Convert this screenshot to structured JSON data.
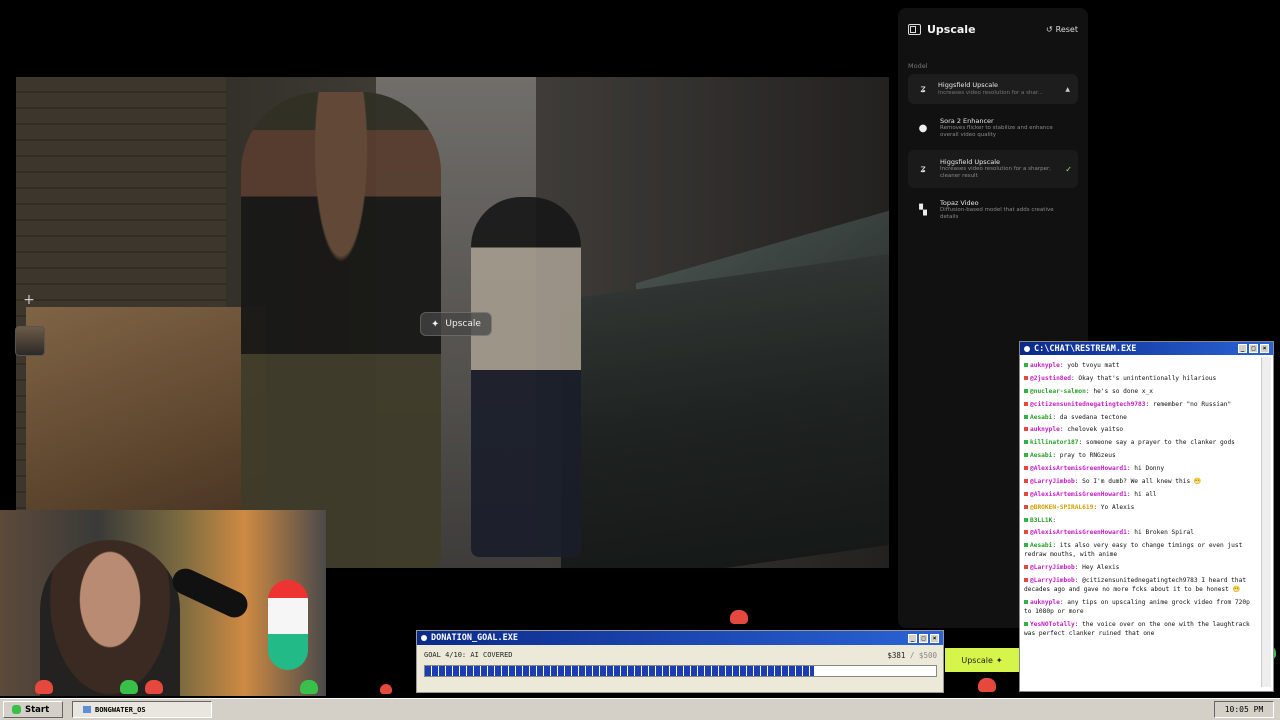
{
  "video": {
    "hover_button_label": "Upscale"
  },
  "panel": {
    "title": "Upscale",
    "reset_label": "Reset",
    "model_label": "Model",
    "selected": {
      "name": "Higgsfield Upscale",
      "desc": "Increases video resolution for a shar..."
    },
    "options": [
      {
        "name": "Sora 2 Enhancer",
        "desc": "Removes flicker to stabilize and enhance overall video quality",
        "icon": "sora-icon",
        "checked": false
      },
      {
        "name": "Higgsfield Upscale",
        "desc": "Increases video resolution for a sharper, cleaner result",
        "icon": "higgsfield-icon",
        "checked": true
      },
      {
        "name": "Topaz Video",
        "desc": "Diffusion-based model that adds creative details",
        "icon": "topaz-icon",
        "checked": false
      }
    ]
  },
  "donation": {
    "title": "DONATION_GOAL.EXE",
    "goal_label": "GOAL 4/10: AI COVERED",
    "amount": "$381",
    "total": "/ $500",
    "progress": 0.762,
    "progress_color": "#1b3fb0"
  },
  "upscale_tag": {
    "label": "Upscale"
  },
  "chat": {
    "title": "C:\\CHAT\\RESTREAM.EXE",
    "messages": [
      {
        "user": "auknyple",
        "text": "yob tvoyu matt",
        "color": "#c21cc2",
        "badge": "#2fb344"
      },
      {
        "user": "@2justin8ed",
        "text": "Okay that's unintentionally hilarious",
        "color": "#c21cc2",
        "badge": "#e5483c"
      },
      {
        "user": "@nuclear-salmon",
        "text": "he's so done x_x",
        "color": "#2a9d2a",
        "badge": "#2fb344"
      },
      {
        "user": "@citizensunitednegatingtech9783",
        "text": "remember \"no Russian\"",
        "color": "#c21cc2",
        "badge": "#e5483c"
      },
      {
        "user": "Aesabi",
        "text": "da svedana tectone",
        "color": "#2a9d2a",
        "badge": "#2fb344"
      },
      {
        "user": "auknyple",
        "text": "chelovek yaitso",
        "color": "#c21cc2",
        "badge": "#e5483c"
      },
      {
        "user": "killinator187",
        "text": "someone say a prayer to the clanker gods",
        "color": "#2a9d2a",
        "badge": "#2fb344"
      },
      {
        "user": "Aesabi",
        "text": "pray to RNGzeus",
        "color": "#2a9d2a",
        "badge": "#2fb344"
      },
      {
        "user": "@AlexisArtemisGreenHoward1",
        "text": "hi Donny",
        "color": "#c21cc2",
        "badge": "#e5483c"
      },
      {
        "user": "@LarryJimbob",
        "text": "So I'm dumb? We all knew this 😁",
        "color": "#c21cc2",
        "badge": "#e5483c"
      },
      {
        "user": "@AlexisArtemisGreenHoward1",
        "text": "hi all",
        "color": "#c21cc2",
        "badge": "#e5483c"
      },
      {
        "user": "@BROKEN-SPIRAL619",
        "text": "Yo Alexis",
        "color": "#d1a000",
        "badge": "#e5483c"
      },
      {
        "user": "B3LL1K",
        "text": "",
        "color": "#2a9d2a",
        "badge": "#2fb344"
      },
      {
        "user": "@AlexisArtemisGreenHoward1",
        "text": "hi Broken Spiral",
        "color": "#c21cc2",
        "badge": "#e5483c"
      },
      {
        "user": "Aesabi",
        "text": "its also very easy to change timings or even just redraw mouths, with anime",
        "color": "#2a9d2a",
        "badge": "#2fb344"
      },
      {
        "user": "@LarryJimbob",
        "text": "Hey Alexis",
        "color": "#c21cc2",
        "badge": "#e5483c"
      },
      {
        "user": "@LarryJimbob",
        "text": "@citizensunitednegatingtech9783 I heard that decades ago and gave no more fcks about it to be honest 😁",
        "color": "#c21cc2",
        "badge": "#e5483c"
      },
      {
        "user": "auknyple",
        "text": "any tips on upscaling anime grock video from 720p to 1080p or more",
        "color": "#c21cc2",
        "badge": "#2fb344"
      },
      {
        "user": "YesNOTotally",
        "text": "the voice over on the one with the laughtrack was perfect clanker ruined that one",
        "color": "#c21cc2",
        "badge": "#2fb344"
      }
    ]
  },
  "taskbar": {
    "start_label": "Start",
    "task_label": "BONGWATER_OS",
    "clock": "10:05 PM"
  }
}
